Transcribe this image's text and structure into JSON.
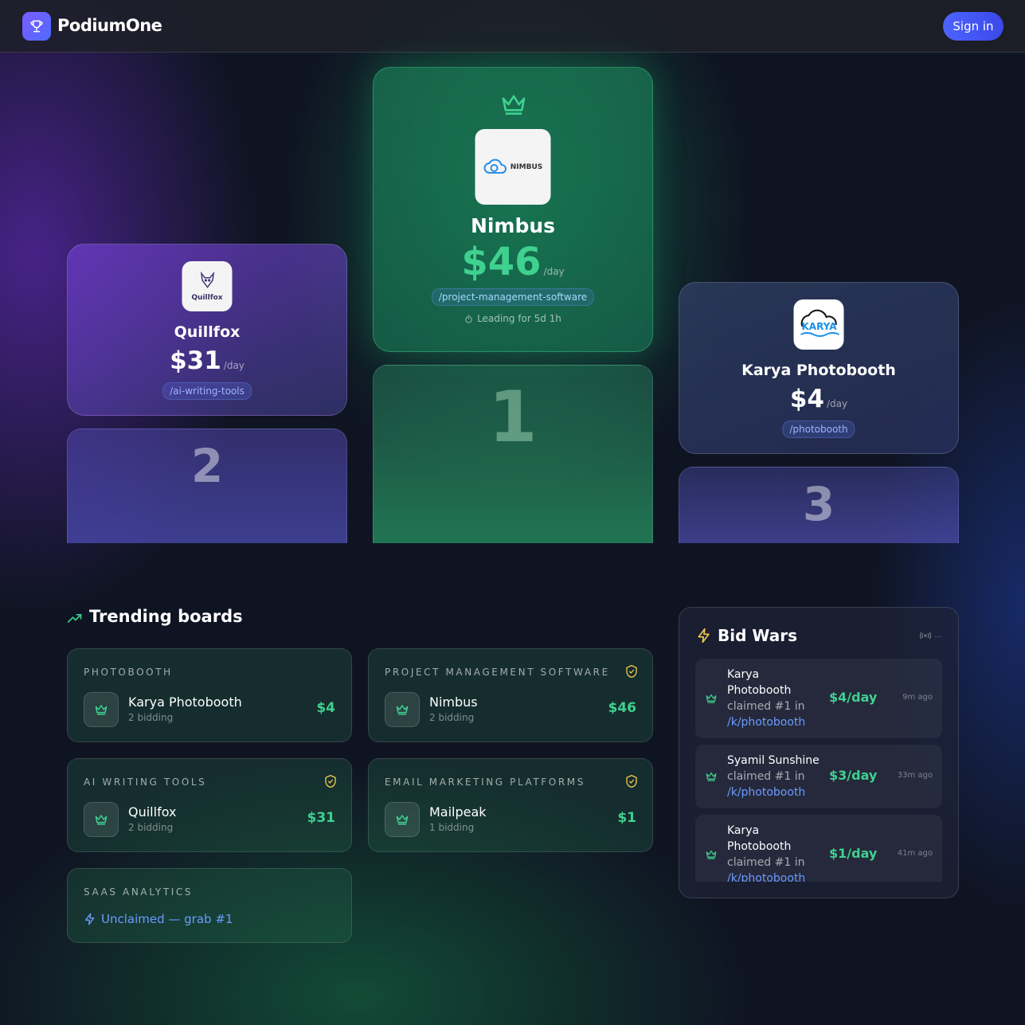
{
  "header": {
    "brand": "PodiumOne",
    "signin_label": "Sign in"
  },
  "podium": {
    "first": {
      "name": "Nimbus",
      "logo_text": "NIMBUS",
      "price": "$46",
      "per": "/day",
      "slug": "/project-management-software",
      "leading": "Leading for 5d 1h",
      "rank": "1"
    },
    "second": {
      "name": "Quillfox",
      "logo_text": "Quillfox",
      "price": "$31",
      "per": "/day",
      "slug": "/ai-writing-tools",
      "rank": "2"
    },
    "third": {
      "name": "Karya Photobooth",
      "logo_text": "KARYA",
      "price": "$4",
      "per": "/day",
      "slug": "/photobooth",
      "rank": "3"
    }
  },
  "trending": {
    "title": "Trending boards",
    "boards": [
      {
        "category": "PHOTOBOOTH",
        "name": "Karya Photobooth",
        "bidding": "2 bidding",
        "price": "$4"
      },
      {
        "category": "PROJECT MANAGEMENT SOFTWARE",
        "name": "Nimbus",
        "bidding": "2 bidding",
        "price": "$46"
      },
      {
        "category": "AI WRITING TOOLS",
        "name": "Quillfox",
        "bidding": "2 bidding",
        "price": "$31"
      },
      {
        "category": "EMAIL MARKETING PLATFORMS",
        "name": "Mailpeak",
        "bidding": "1 bidding",
        "price": "$1"
      },
      {
        "category": "SAAS ANALYTICS",
        "unclaimed": "Unclaimed — grab #1"
      }
    ]
  },
  "bidwars": {
    "title": "Bid Wars",
    "live": "...",
    "items": [
      {
        "who": "Karya Photobooth",
        "action": "claimed #1 in",
        "where": "/k/photobooth",
        "amount": "$4/day",
        "ago": "9m ago"
      },
      {
        "who": "Syamil Sunshine",
        "action": "claimed #1 in",
        "where": "/k/photobooth",
        "amount": "$3/day",
        "ago": "33m ago"
      },
      {
        "who": "Karya Photobooth",
        "action": "claimed #1 in",
        "where": "/k/photobooth",
        "amount": "$1/day",
        "ago": "41m ago"
      }
    ]
  },
  "colors": {
    "accent_green": "#3fd18f",
    "accent_blue": "#4d63ff",
    "link_blue": "#6b9bff",
    "shield_yellow": "#f2c94c"
  },
  "icons": [
    "trophy-icon",
    "crown-icon",
    "timer-icon",
    "trending-up-icon",
    "shield-check-icon",
    "bolt-icon",
    "broadcast-icon"
  ]
}
